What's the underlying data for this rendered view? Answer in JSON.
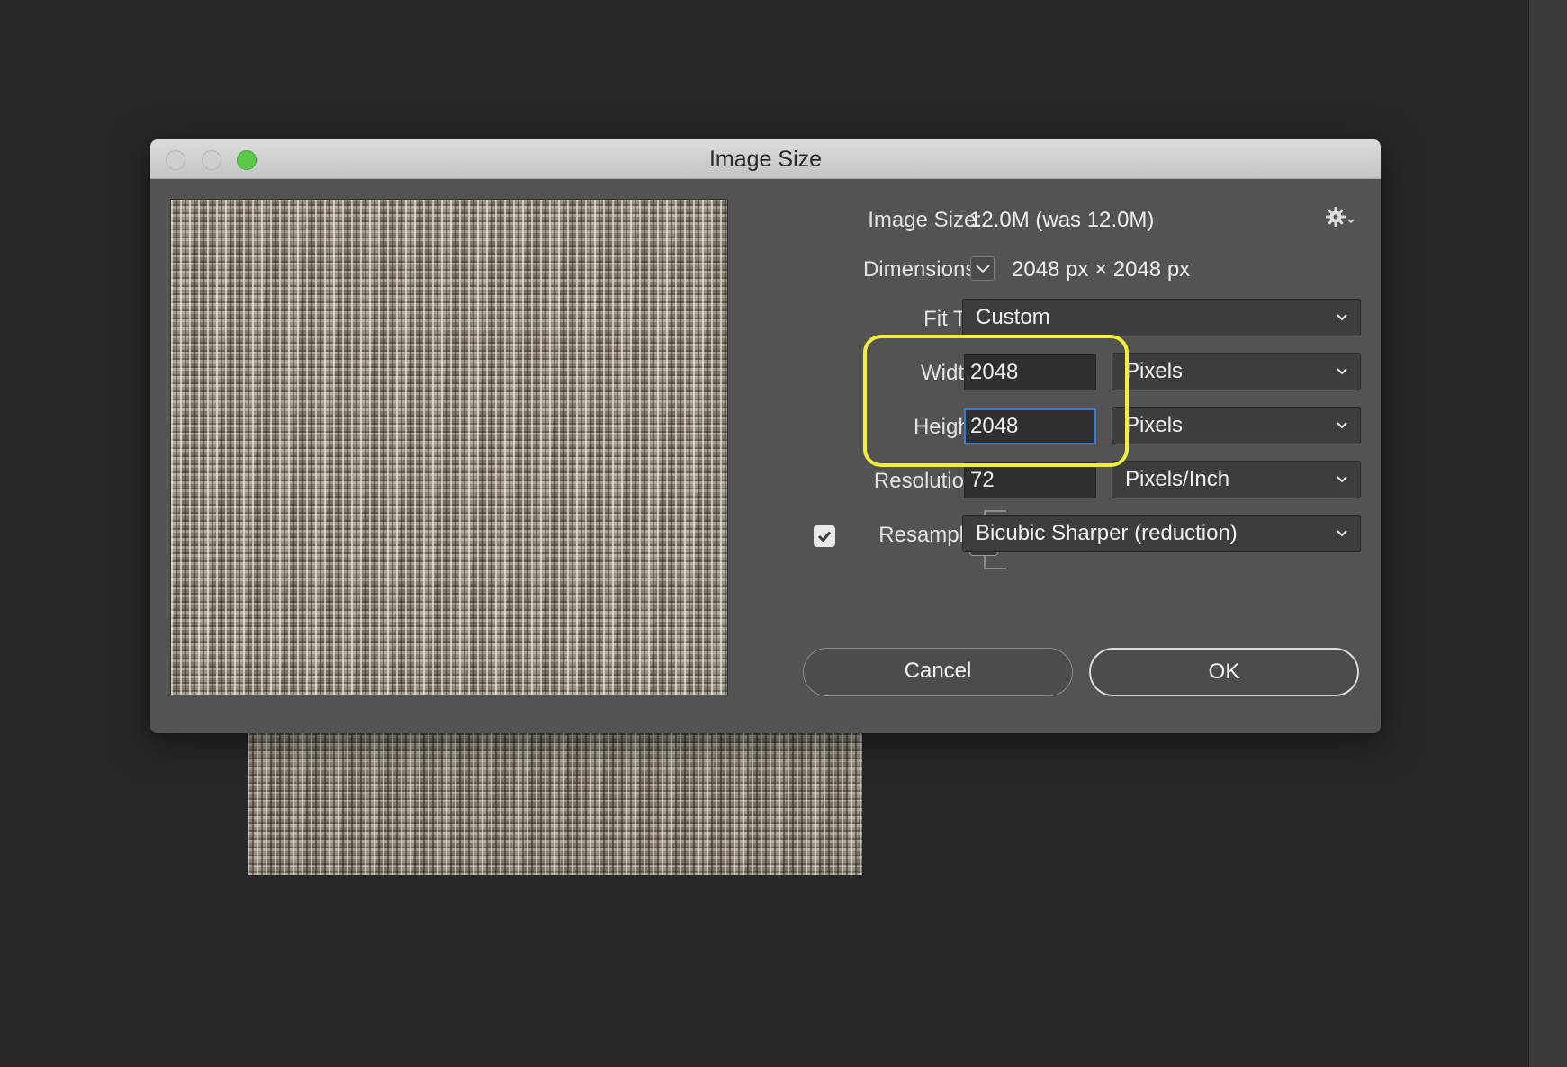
{
  "dialog": {
    "title": "Image Size",
    "image_size_label": "Image Size:",
    "image_size_value": "12.0M (was 12.0M)",
    "dimensions_label": "Dimensions:",
    "dimensions_value": "2048 px  ×  2048 px",
    "fit_to_label": "Fit To:",
    "fit_to_value": "Custom",
    "width_label": "Width:",
    "width_value": "2048",
    "width_unit": "Pixels",
    "height_label": "Height:",
    "height_value": "2048",
    "height_unit": "Pixels",
    "resolution_label": "Resolution:",
    "resolution_value": "72",
    "resolution_unit": "Pixels/Inch",
    "resample_label": "Resample:",
    "resample_checked": true,
    "resample_value": "Bicubic Sharper (reduction)",
    "cancel_label": "Cancel",
    "ok_label": "OK"
  },
  "icons": {
    "gear": "gear-icon",
    "link": "link-icon",
    "dimensions_toggle": "chevron-down-icon",
    "select_arrow": "chevron-down-icon",
    "checkbox": "checkmark-icon"
  },
  "colors": {
    "highlight": "#f2ee3b",
    "focus": "#3b79c9",
    "zoom_button": "#5ac948"
  }
}
